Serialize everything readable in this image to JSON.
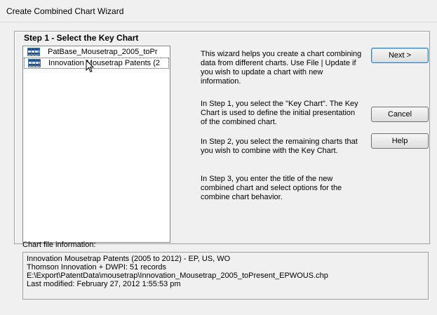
{
  "window": {
    "title": "Create Combined Chart Wizard"
  },
  "step": {
    "title": "Step 1 - Select the Key Chart"
  },
  "chart_list": {
    "items": [
      {
        "label": "PatBase_Mousetrap_2005_toPr",
        "selected": false
      },
      {
        "label": "Innovation Mousetrap Patents (2",
        "selected": true
      }
    ]
  },
  "instructions": {
    "p1": "This wizard helps you create a chart combining data from different charts. Use File | Update if you wish to update a chart with new information.",
    "p2": "In Step 1, you select the \"Key Chart\". The Key Chart is used to define the initial presentation of the combined chart.",
    "p3": "In Step 2, you select the remaining charts that you wish to combine with the Key Chart.",
    "p4": "In Step 3, you enter the title of the new combined chart and select options for the combine chart behavior."
  },
  "buttons": {
    "next": "Next >",
    "cancel": "Cancel",
    "help": "Help"
  },
  "chart_file_info": {
    "label": "Chart file information:",
    "lines": [
      "Innovation Mousetrap Patents (2005 to 2012) - EP, US, WO",
      "Thomson Innovation + DWPI: 51 records",
      "E:\\Export\\PatentData\\mousetrap\\Innovation_Mousetrap_2005_toPresent_EPWOUS.chp",
      "Last modified: February 27, 2012 1:55:53 pm"
    ]
  }
}
